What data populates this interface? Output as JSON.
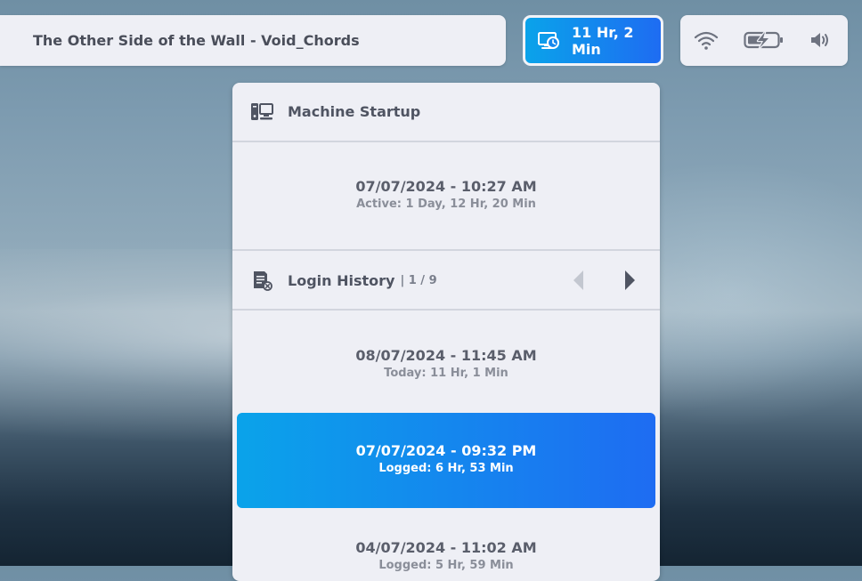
{
  "now_playing": {
    "title": "The Other Side of the Wall - Void_Chords"
  },
  "uptime": {
    "label": "11 Hr, 2 Min",
    "icon": "monitor-clock-icon"
  },
  "status_tray": {
    "wifi_icon": "wifi-icon",
    "battery_icon": "battery-charging-icon",
    "volume_icon": "speaker-icon"
  },
  "machine_startup": {
    "header_label": "Machine Startup",
    "icon": "computer-tower-icon",
    "datetime": "07/07/2024 - 10:27 AM",
    "detail": "Active: 1 Day, 12 Hr, 20 Min"
  },
  "login_history": {
    "header_label": "Login History",
    "page_indicator": "| 1 / 9",
    "icon": "history-log-icon",
    "entries": [
      {
        "datetime": "08/07/2024 - 11:45 AM",
        "detail": "Today: 11 Hr, 1 Min",
        "selected": false
      },
      {
        "datetime": "07/07/2024 - 09:32 PM",
        "detail": "Logged: 6 Hr, 53 Min",
        "selected": true
      },
      {
        "datetime": "04/07/2024 - 11:02 AM",
        "detail": "Logged: 5 Hr, 59 Min",
        "selected": false
      }
    ]
  },
  "colors": {
    "accent_start": "#0aa3ea",
    "accent_end": "#1e6cf2",
    "panel_bg": "#eeeff5",
    "text_primary": "#5a5e6b",
    "text_secondary": "#8a8e99"
  }
}
